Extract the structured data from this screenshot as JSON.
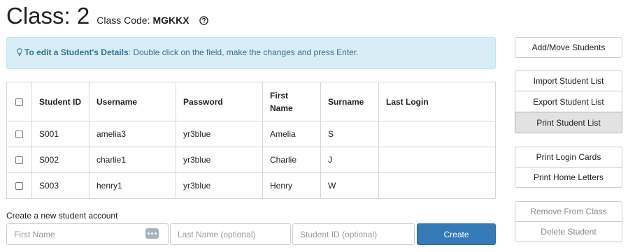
{
  "header": {
    "class_title": "Class: 2",
    "class_code_label": "Class Code:",
    "class_code_value": "MGKKX"
  },
  "alert": {
    "bold_text": "To edit a Student's Details",
    "text": ": Double click on the field, make the changes and press Enter."
  },
  "table": {
    "columns": [
      "Student ID",
      "Username",
      "Password",
      "First Name",
      "Surname",
      "Last Login"
    ],
    "rows": [
      {
        "student_id": "S001",
        "username": "amelia3",
        "password": "yr3blue",
        "first_name": "Amelia",
        "surname": "S",
        "last_login": ""
      },
      {
        "student_id": "S002",
        "username": "charlie1",
        "password": "yr3blue",
        "first_name": "Charlie",
        "surname": "J",
        "last_login": ""
      },
      {
        "student_id": "S003",
        "username": "henry1",
        "password": "yr3blue",
        "first_name": "Henry",
        "surname": "W",
        "last_login": ""
      }
    ]
  },
  "create": {
    "label": "Create a new student account",
    "first_name_placeholder": "First Name",
    "last_name_placeholder": "Last Name (optional)",
    "student_id_placeholder": "Student ID (optional)",
    "button_label": "Create"
  },
  "sidebar": {
    "add_move": "Add/Move Students",
    "import": "Import Student List",
    "export": "Export Student List",
    "print_list": "Print Student List",
    "print_cards": "Print Login Cards",
    "print_letters": "Print Home Letters",
    "remove": "Remove From Class",
    "delete": "Delete Student"
  },
  "colors": {
    "alert_bg": "#d9edf7",
    "alert_text": "#31708f",
    "primary": "#337ab7",
    "active_button_bg": "#e2e2e2",
    "disabled_text": "#888888"
  },
  "icons": {
    "help": "question-circle-icon",
    "tip": "lightbulb-icon",
    "autofill": "more-dots-icon"
  }
}
